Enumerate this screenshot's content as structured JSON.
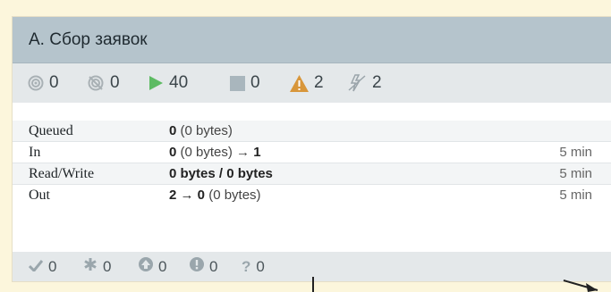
{
  "processor": {
    "title": "А. Сбор заявок"
  },
  "status": {
    "running_inactive": "0",
    "disabled": "0",
    "running": "40",
    "stopped": "0",
    "invalid": "2",
    "disabled_components": "2"
  },
  "stats": [
    {
      "label": "Queued",
      "value_bold": "0",
      "value_rest": " (0 bytes)",
      "time": ""
    },
    {
      "label": "In",
      "value_bold": "0",
      "value_rest": " (0 bytes) → ",
      "value_bold2": "1",
      "time": "5 min"
    },
    {
      "label": "Read/Write",
      "value_bold": "0 bytes / 0 bytes",
      "value_rest": "",
      "time": "5 min"
    },
    {
      "label": "Out",
      "value_bold": "2 → 0",
      "value_rest": " (0 bytes)",
      "time": "5 min"
    }
  ],
  "footer": {
    "up_to_date": "0",
    "locally_modified": "0",
    "stale": "0",
    "modified_stale": "0",
    "sync_failure": "0"
  },
  "colors": {
    "header_bg": "#b5c4cc",
    "running": "#5dbb63",
    "warning": "#d8963a"
  }
}
